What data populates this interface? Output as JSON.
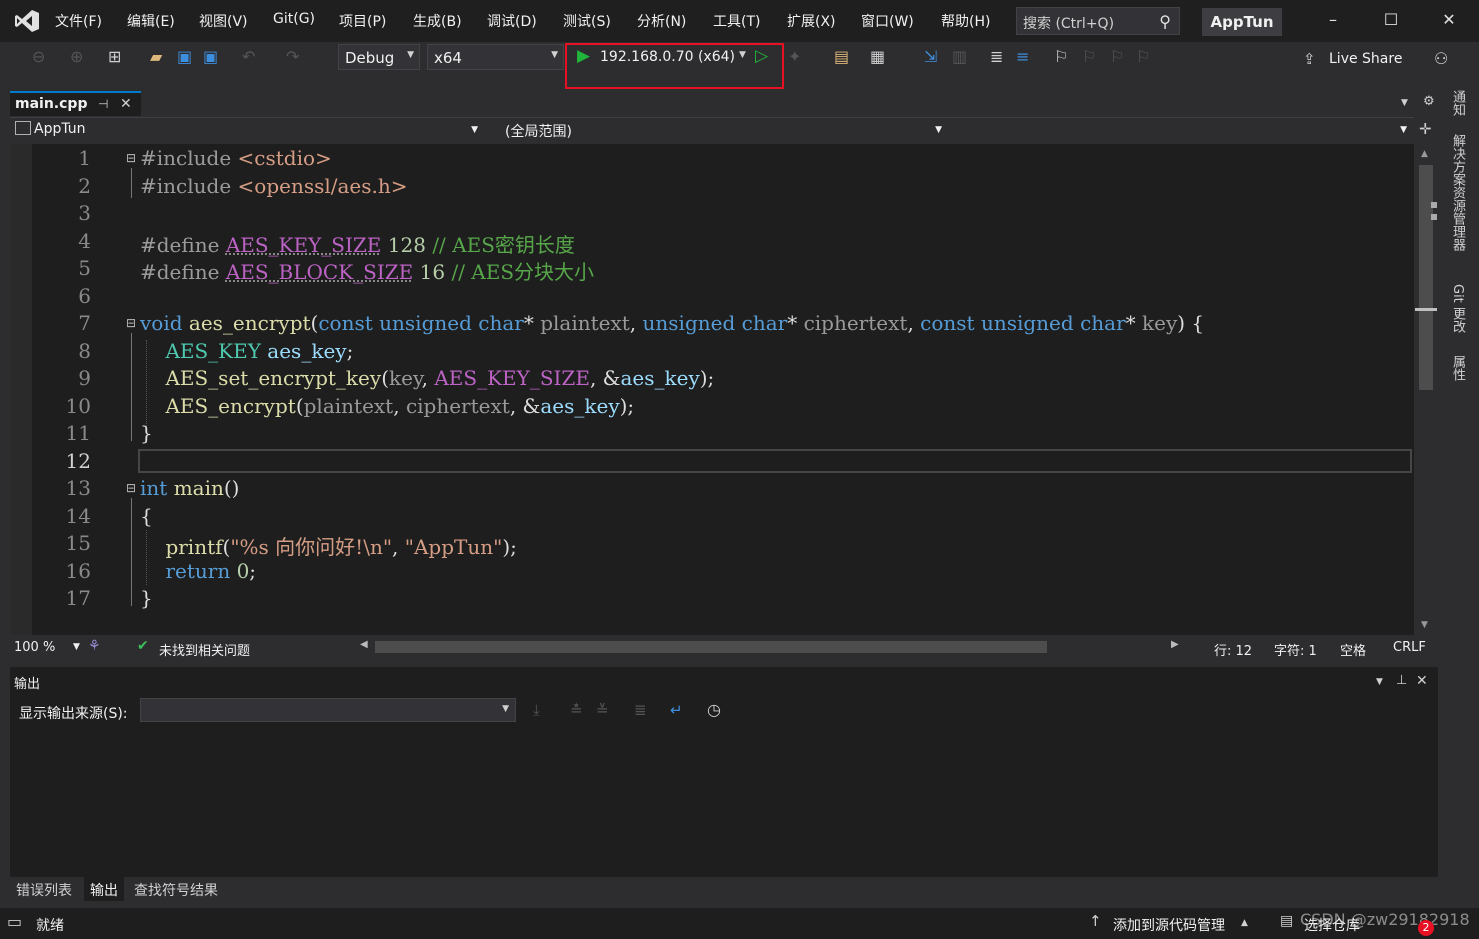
{
  "menu": {
    "items": [
      "文件(F)",
      "编辑(E)",
      "视图(V)",
      "Git(G)",
      "项目(P)",
      "生成(B)",
      "调试(D)",
      "测试(S)",
      "分析(N)",
      "工具(T)",
      "扩展(X)",
      "窗口(W)",
      "帮助(H)"
    ],
    "search_placeholder": "搜索 (Ctrl+Q)",
    "app_badge": "AppTun"
  },
  "toolbar": {
    "config": "Debug",
    "platform": "x64",
    "run_target": "192.168.0.70 (x64)",
    "live_share": "Live Share"
  },
  "editor": {
    "tab_title": "main.cpp",
    "nav_project": "AppTun",
    "nav_scope": "(全局范围)",
    "current_line": "12",
    "line_numbers": [
      "1",
      "2",
      "3",
      "4",
      "5",
      "6",
      "7",
      "8",
      "9",
      "10",
      "11",
      "12",
      "13",
      "14",
      "15",
      "16",
      "17"
    ]
  },
  "editor_status": {
    "zoom": "100 %",
    "issues": "未找到相关问题",
    "line": "行: 12",
    "char": "字符: 1",
    "whitespace": "空格",
    "eol": "CRLF"
  },
  "output": {
    "title": "输出",
    "source_label": "显示输出来源(S):",
    "source_value": ""
  },
  "bottom_tabs": [
    "错误列表",
    "输出",
    "查找符号结果"
  ],
  "statusbar": {
    "ready": "就绪",
    "add_to_source_control": "添加到源代码管理",
    "select_repo": "选择仓库",
    "notification_count": "2",
    "watermark": "CSDN @zw29182918"
  },
  "right_rail": [
    "通知",
    "解决方案资源管理器",
    "Git 更改",
    "属性"
  ],
  "colors": {
    "accent": "#007acc",
    "highlight_box": "#e81123",
    "run_green": "#1eb53a"
  }
}
